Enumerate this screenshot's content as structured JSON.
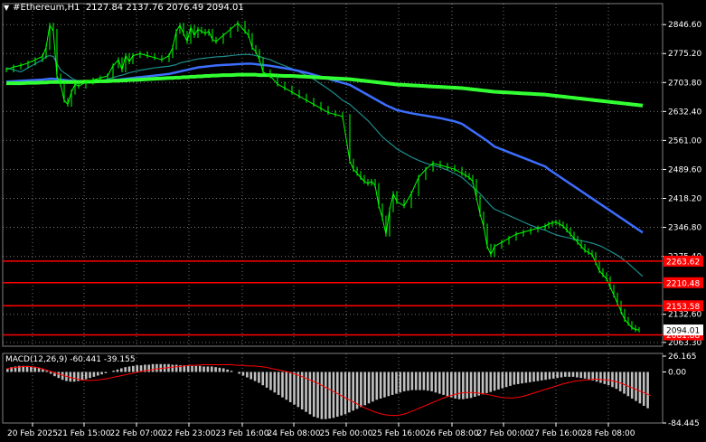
{
  "header": {
    "symbol": "#Ethereum,H1",
    "ohlc": "2127.84 2137.76 2076.49 2094.01"
  },
  "colors": {
    "background": "#000000",
    "candle": "#00ff00",
    "ma_fast": "#1e8c8c",
    "ma_mid": "#3c6eff",
    "ma_slow": "#32ff32",
    "level": "#ff0000",
    "macd_hist": "#c0c0c0",
    "macd_signal": "#ff0000",
    "grid": "#ffffff"
  },
  "chart_data": [
    {
      "type": "line",
      "title": "#Ethereum,H1",
      "y_ticks": [
        "2846.60",
        "2775.20",
        "2703.80",
        "2632.40",
        "2561.00",
        "2489.60",
        "2418.20",
        "2346.80",
        "2275.40",
        "2132.60",
        "2063.30"
      ],
      "ylim": [
        2054,
        2876
      ],
      "x_ticks": [
        "20 Feb 2025",
        "21 Feb 15:00",
        "22 Feb 07:00",
        "22 Feb 23:00",
        "23 Feb 16:00",
        "24 Feb 08:00",
        "25 Feb 00:00",
        "25 Feb 16:00",
        "26 Feb 08:00",
        "27 Feb 00:00",
        "27 Feb 16:00",
        "28 Feb 08:00"
      ],
      "grid": true,
      "price_x": [
        0,
        8,
        16,
        24,
        32,
        40,
        44,
        48,
        52,
        56,
        60,
        64,
        68,
        72,
        76,
        80,
        88,
        96,
        104,
        112,
        118,
        124,
        128,
        132,
        136,
        140,
        148,
        156,
        164,
        172,
        180,
        184,
        188,
        192,
        196,
        200,
        204,
        208,
        212,
        216,
        220,
        224,
        228,
        232,
        240,
        248,
        256,
        264,
        268,
        272,
        276,
        280,
        284,
        292,
        300,
        308,
        316,
        324,
        332,
        340,
        348,
        356,
        364,
        372,
        380,
        384,
        388,
        392,
        396,
        400,
        404,
        408,
        412,
        416,
        420,
        424,
        428,
        432,
        440,
        448,
        456,
        464,
        472,
        480,
        488,
        496,
        504,
        508,
        512,
        516,
        520,
        524,
        528,
        532,
        536,
        540,
        548,
        556,
        564,
        572,
        580,
        588,
        596,
        600,
        604,
        608,
        612,
        616,
        620,
        624,
        628,
        632,
        636,
        640,
        644,
        648,
        652,
        656,
        660,
        664,
        668,
        672,
        676,
        680,
        684,
        688,
        692,
        696,
        700,
        704
      ],
      "series": [
        {
          "name": "#Ethereum,H1",
          "values": [
            2735,
            2742,
            2746,
            2752,
            2760,
            2768,
            2790,
            2845,
            2830,
            2720,
            2700,
            2660,
            2650,
            2680,
            2700,
            2695,
            2705,
            2710,
            2715,
            2720,
            2745,
            2760,
            2735,
            2770,
            2755,
            2770,
            2775,
            2770,
            2765,
            2760,
            2770,
            2790,
            2830,
            2845,
            2825,
            2805,
            2840,
            2820,
            2835,
            2830,
            2825,
            2830,
            2810,
            2805,
            2820,
            2835,
            2850,
            2830,
            2820,
            2790,
            2780,
            2760,
            2730,
            2720,
            2700,
            2690,
            2680,
            2670,
            2660,
            2650,
            2640,
            2630,
            2625,
            2620,
            2510,
            2490,
            2480,
            2470,
            2460,
            2455,
            2460,
            2450,
            2400,
            2370,
            2330,
            2390,
            2430,
            2410,
            2400,
            2430,
            2470,
            2490,
            2505,
            2500,
            2495,
            2490,
            2480,
            2475,
            2470,
            2460,
            2420,
            2380,
            2350,
            2300,
            2280,
            2300,
            2310,
            2320,
            2330,
            2335,
            2340,
            2345,
            2350,
            2355,
            2358,
            2360,
            2355,
            2350,
            2340,
            2330,
            2320,
            2310,
            2300,
            2290,
            2285,
            2280,
            2260,
            2240,
            2230,
            2220,
            2200,
            2180,
            2160,
            2140,
            2120,
            2110,
            2100,
            2095,
            2094
          ]
        },
        {
          "name": "",
          "values": [
            2740,
            2735,
            2730,
            2740,
            2750,
            2760,
            2768,
            2770,
            2768,
            2750,
            2735,
            2728,
            2722,
            2715,
            2710,
            2708,
            2706,
            2706,
            2708,
            2712,
            2716,
            2720,
            2722,
            2725,
            2728,
            2730,
            2734,
            2737,
            2740,
            2742,
            2744,
            2746,
            2748,
            2752,
            2754,
            2756,
            2758,
            2760,
            2762,
            2763,
            2764,
            2765,
            2766,
            2767,
            2768,
            2770,
            2772,
            2773,
            2773,
            2772,
            2770,
            2768,
            2765,
            2760,
            2752,
            2745,
            2738,
            2730,
            2722,
            2712,
            2700,
            2688,
            2675,
            2660,
            2650,
            2642,
            2634,
            2626,
            2618,
            2610,
            2600,
            2590,
            2580,
            2570,
            2562,
            2555,
            2548,
            2540,
            2530,
            2520,
            2512,
            2505,
            2500,
            2495,
            2488,
            2480,
            2470,
            2462,
            2454,
            2446,
            2438,
            2430,
            2420,
            2410,
            2400,
            2392,
            2384,
            2376,
            2368,
            2360,
            2352,
            2345,
            2340,
            2336,
            2332,
            2329,
            2326,
            2324,
            2322,
            2320,
            2318,
            2316,
            2314,
            2312,
            2310,
            2308,
            2305,
            2302,
            2298,
            2293,
            2288,
            2283,
            2278,
            2272,
            2265,
            2258,
            2250,
            2242,
            2234,
            2226,
            2220
          ]
        },
        {
          "name": "",
          "values": [
            2706,
            2707,
            2708,
            2709,
            2710,
            2711,
            2712,
            2713,
            2713,
            2712,
            2711,
            2710,
            2709,
            2708,
            2707,
            2707,
            2707,
            2707,
            2708,
            2709,
            2710,
            2711,
            2712,
            2713,
            2714,
            2715,
            2717,
            2719,
            2721,
            2723,
            2725,
            2727,
            2729,
            2731,
            2733,
            2735,
            2737,
            2739,
            2741,
            2742,
            2743,
            2744,
            2745,
            2746,
            2747,
            2748,
            2749,
            2750,
            2750,
            2750,
            2749,
            2748,
            2747,
            2745,
            2742,
            2739,
            2736,
            2732,
            2728,
            2723,
            2718,
            2713,
            2708,
            2703,
            2698,
            2693,
            2688,
            2683,
            2678,
            2673,
            2668,
            2663,
            2658,
            2653,
            2648,
            2644,
            2640,
            2636,
            2632,
            2628,
            2625,
            2622,
            2619,
            2616,
            2612,
            2608,
            2602,
            2596,
            2590,
            2584,
            2578,
            2572,
            2566,
            2560,
            2553,
            2546,
            2539,
            2532,
            2525,
            2518,
            2511,
            2504,
            2497,
            2490,
            2484,
            2478,
            2472,
            2466,
            2460,
            2454,
            2448,
            2442,
            2436,
            2430,
            2424,
            2418,
            2412,
            2406,
            2400,
            2394,
            2388,
            2382,
            2376,
            2370,
            2364,
            2358,
            2352,
            2346,
            2340,
            2334,
            2330
          ]
        },
        {
          "name": "",
          "values": [
            2702,
            2702,
            2702,
            2703,
            2703,
            2704,
            2704,
            2705,
            2705,
            2705,
            2705,
            2705,
            2705,
            2705,
            2705,
            2705,
            2706,
            2706,
            2707,
            2707,
            2708,
            2708,
            2709,
            2709,
            2710,
            2710,
            2711,
            2712,
            2713,
            2714,
            2715,
            2715,
            2716,
            2716,
            2717,
            2717,
            2718,
            2718,
            2719,
            2719,
            2720,
            2720,
            2721,
            2721,
            2722,
            2722,
            2723,
            2723,
            2723,
            2723,
            2723,
            2722,
            2722,
            2722,
            2721,
            2720,
            2720,
            2719,
            2718,
            2717,
            2716,
            2715,
            2714,
            2713,
            2712,
            2711,
            2710,
            2709,
            2708,
            2707,
            2706,
            2705,
            2704,
            2703,
            2702,
            2701,
            2700,
            2699,
            2698,
            2697,
            2696,
            2695,
            2694,
            2693,
            2692,
            2691,
            2690,
            2689,
            2688,
            2687,
            2686,
            2685,
            2684,
            2683,
            2682,
            2681,
            2680,
            2679,
            2678,
            2677,
            2676,
            2675,
            2674,
            2673,
            2672,
            2671,
            2670,
            2669,
            2668,
            2667,
            2666,
            2665,
            2664,
            2663,
            2662,
            2661,
            2660,
            2659,
            2658,
            2657,
            2656,
            2655,
            2654,
            2653,
            2652,
            2651,
            2650,
            2649,
            2648,
            2647,
            2646,
            2645
          ]
        }
      ],
      "levels": [
        {
          "label": "2263.62",
          "value": 2263.62
        },
        {
          "label": "2210.48",
          "value": 2210.48
        },
        {
          "label": "2153.58",
          "value": 2153.58
        },
        {
          "label": "2081.88",
          "value": 2081.88
        }
      ],
      "price_label": "2094.01"
    },
    {
      "type": "bar",
      "title": "MACD(12,26,9) -60.441 -39.155",
      "ylim": [
        -84.445,
        26.165
      ],
      "y_ticks": [
        "26.165",
        "0.00",
        "-84.445"
      ],
      "histogram": [
        6,
        8,
        9,
        10,
        10,
        10,
        9,
        8,
        7,
        5,
        2,
        -3,
        -7,
        -10,
        -13,
        -15,
        -16,
        -16,
        -15,
        -14,
        -12,
        -10,
        -8,
        -6,
        -4,
        -2,
        0,
        2,
        4,
        6,
        8,
        9,
        10,
        11,
        11,
        12,
        12,
        13,
        13,
        13,
        13,
        13,
        12,
        12,
        11,
        11,
        11,
        10,
        10,
        10,
        9,
        9,
        9,
        8,
        7,
        6,
        4,
        2,
        0,
        -3,
        -6,
        -9,
        -12,
        -15,
        -18,
        -22,
        -26,
        -30,
        -34,
        -38,
        -42,
        -46,
        -50,
        -54,
        -58,
        -62,
        -66,
        -70,
        -74,
        -76,
        -78,
        -78,
        -77,
        -76,
        -74,
        -72,
        -70,
        -67,
        -64,
        -61,
        -58,
        -55,
        -52,
        -49,
        -46,
        -44,
        -42,
        -40,
        -38,
        -36,
        -34,
        -32,
        -31,
        -30,
        -30,
        -30,
        -30,
        -31,
        -32,
        -34,
        -36,
        -38,
        -40,
        -42,
        -44,
        -45,
        -45,
        -44,
        -43,
        -41,
        -39,
        -37,
        -35,
        -33,
        -31,
        -29,
        -27,
        -25,
        -23,
        -21,
        -20,
        -19,
        -18,
        -17,
        -16,
        -15,
        -14,
        -13,
        -12,
        -11,
        -10,
        -9,
        -8,
        -8,
        -8,
        -9,
        -10,
        -11,
        -12,
        -14,
        -16,
        -18,
        -20,
        -22,
        -25,
        -28,
        -32,
        -36,
        -40,
        -44,
        -48,
        -52,
        -56,
        -60
      ],
      "signal": [
        5,
        7,
        8,
        9,
        9,
        8,
        6,
        3,
        0,
        -3,
        -6,
        -9,
        -11,
        -13,
        -14,
        -14,
        -13,
        -12,
        -10,
        -8,
        -6,
        -4,
        -2,
        0,
        2,
        3,
        5,
        6,
        7,
        8,
        9,
        10,
        11,
        11,
        12,
        12,
        12,
        12,
        12,
        12,
        11,
        11,
        10,
        10,
        9,
        8,
        6,
        4,
        2,
        0,
        -3,
        -6,
        -10,
        -14,
        -18,
        -23,
        -28,
        -33,
        -38,
        -43,
        -48,
        -53,
        -58,
        -62,
        -66,
        -69,
        -71,
        -72,
        -72,
        -70,
        -67,
        -63,
        -59,
        -55,
        -51,
        -47,
        -43,
        -40,
        -37,
        -35,
        -34,
        -34,
        -35,
        -36,
        -38,
        -40,
        -42,
        -43,
        -43,
        -42,
        -40,
        -37,
        -34,
        -31,
        -28,
        -25,
        -22,
        -19,
        -17,
        -15,
        -14,
        -13,
        -12,
        -12,
        -13,
        -14,
        -16,
        -19,
        -23,
        -27,
        -31,
        -35,
        -39
      ],
      "signal_name": ""
    }
  ]
}
